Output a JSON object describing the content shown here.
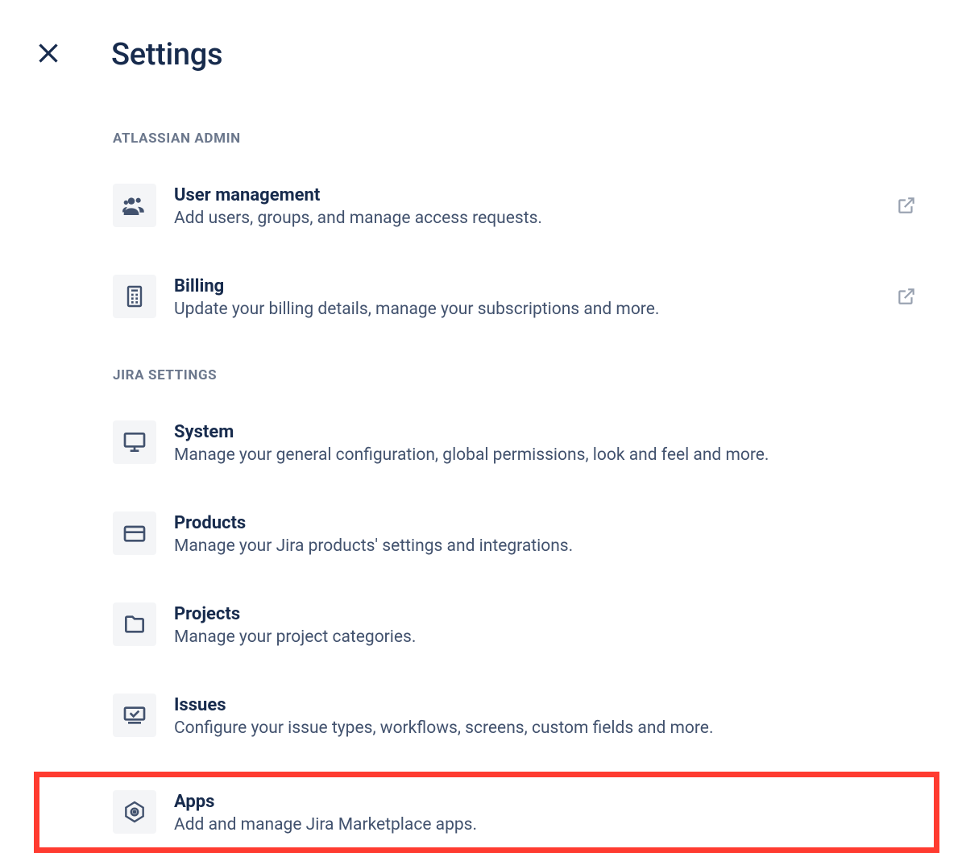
{
  "page": {
    "title": "Settings"
  },
  "sections": {
    "admin": {
      "heading": "ATLASSIAN ADMIN",
      "items": [
        {
          "title": "User management",
          "desc": "Add users, groups, and manage access requests."
        },
        {
          "title": "Billing",
          "desc": "Update your billing details, manage your subscriptions and more."
        }
      ]
    },
    "jira": {
      "heading": "JIRA SETTINGS",
      "items": [
        {
          "title": "System",
          "desc": "Manage your general configuration, global permissions, look and feel and more."
        },
        {
          "title": "Products",
          "desc": "Manage your Jira products' settings and integrations."
        },
        {
          "title": "Projects",
          "desc": "Manage your project categories."
        },
        {
          "title": "Issues",
          "desc": "Configure your issue types, workflows, screens, custom fields and more."
        },
        {
          "title": "Apps",
          "desc": "Add and manage Jira Marketplace apps."
        }
      ]
    }
  }
}
